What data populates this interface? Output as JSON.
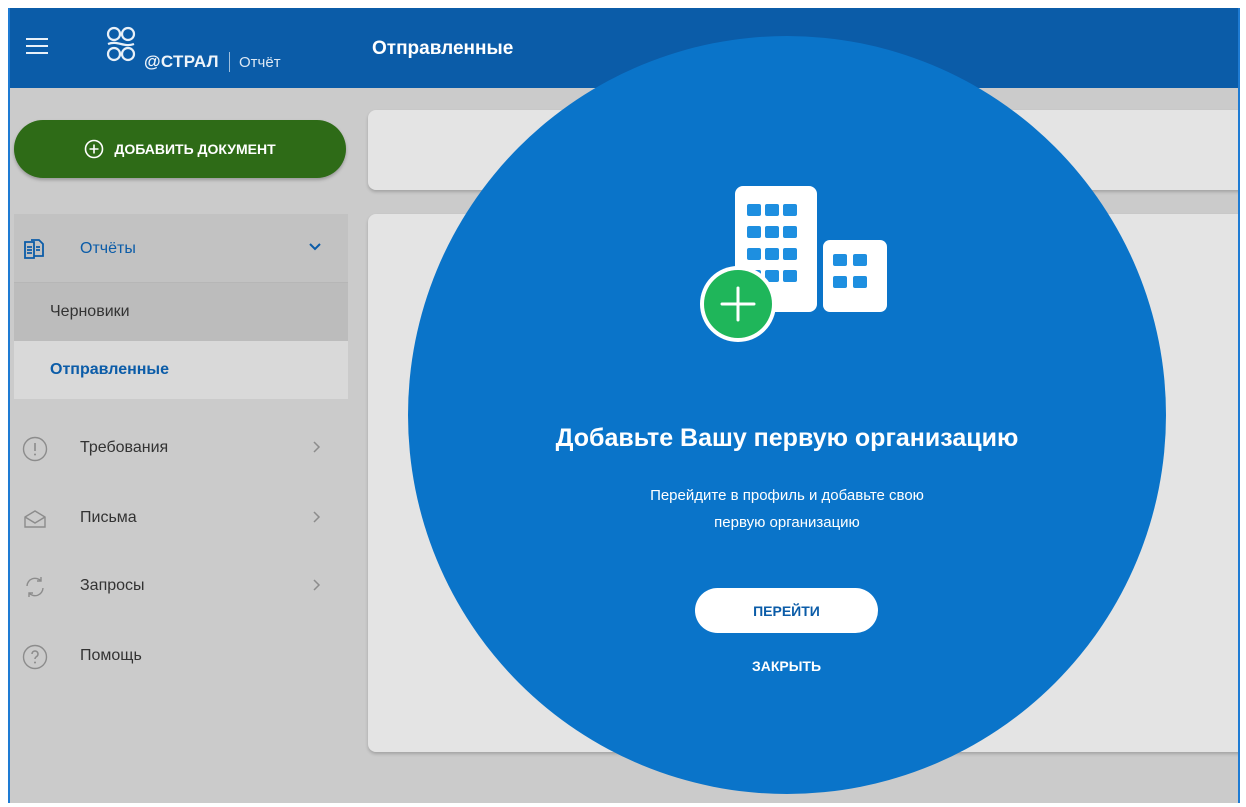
{
  "header": {
    "brand_word": "@СТРАЛ",
    "brand_product": "Отчёт",
    "page_title": "Отправленные",
    "menu_icon": "hamburger-icon"
  },
  "sidebar": {
    "add_document_label": "ДОБАВИТЬ ДОКУМЕНТ",
    "group": {
      "label": "Отчёты",
      "items": [
        {
          "label": "Черновики",
          "active": false
        },
        {
          "label": "Отправленные",
          "active": true
        }
      ]
    },
    "items": [
      {
        "label": "Требования",
        "icon": "exclamation-circle-icon",
        "has_chevron": true
      },
      {
        "label": "Письма",
        "icon": "envelope-icon",
        "has_chevron": true
      },
      {
        "label": "Запросы",
        "icon": "refresh-icon",
        "has_chevron": true
      },
      {
        "label": "Помощь",
        "icon": "question-circle-icon",
        "has_chevron": false
      }
    ]
  },
  "overlay": {
    "title": "Добавьте Вашу первую организацию",
    "text_line1": "Перейдите в профиль и добавьте свою",
    "text_line2": "первую организацию",
    "go_label": "ПЕРЕЙТИ",
    "close_label": "ЗАКРЫТЬ"
  },
  "colors": {
    "header": "#0b5ca8",
    "overlay": "#0a74c9",
    "add_button": "#2e6b17",
    "accent_green": "#1fb65a",
    "active_text": "#0b5ca8"
  }
}
